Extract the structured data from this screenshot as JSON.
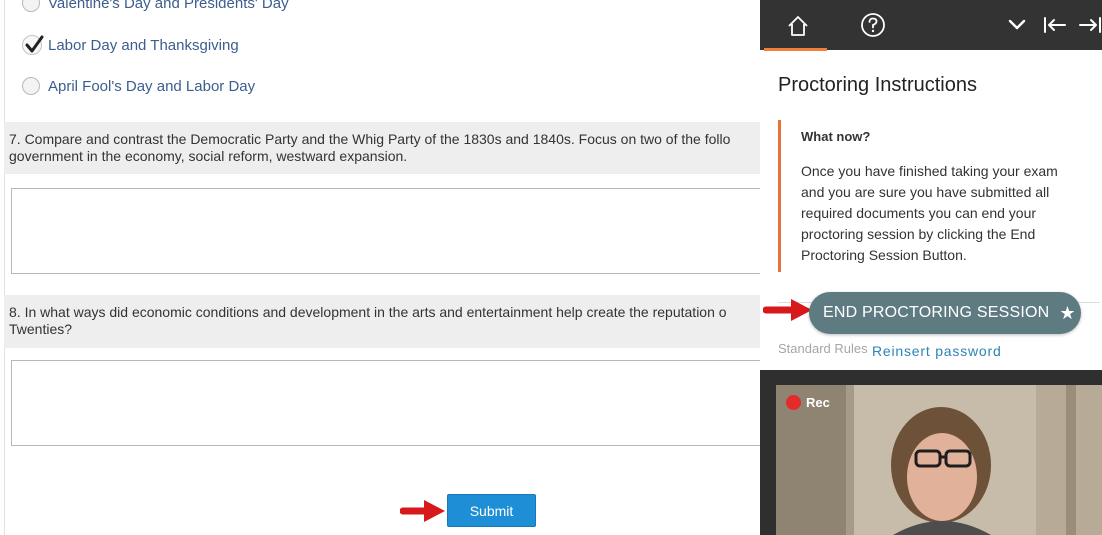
{
  "exam": {
    "options": [
      {
        "label": "Valentine's Day and Presidents' Day",
        "checked": false
      },
      {
        "label": "Labor Day and Thanksgiving",
        "checked": true
      },
      {
        "label": "April Fool's Day and Labor Day",
        "checked": false
      }
    ],
    "question7": {
      "line1": "7. Compare and contrast the Democratic Party and the Whig Party of the 1830s and 1840s. Focus on two of the follo",
      "line2": "government in the economy, social reform, westward expansion."
    },
    "question8": {
      "line1": "8. In what ways did economic conditions and development in the arts and entertainment help create the reputation o",
      "line2": "Twenties?"
    },
    "submit_label": "Submit"
  },
  "panel": {
    "title": "Proctoring Instructions",
    "info_heading": "What now?",
    "info_lines": [
      "Once you have finished taking your exam",
      "and you are sure you have submitted all",
      "required documents you can end your",
      "proctoring session by clicking the End",
      "Proctoring Session Button."
    ],
    "end_button_label": "END PROCTORING SESSION",
    "standard_rules": "Standard Rules",
    "reinsert_password": "Reinsert password",
    "rec_label": "Rec"
  },
  "colors": {
    "accent_orange": "#f07f3c",
    "end_button": "#5f7b82",
    "submit_button": "#1e8fd6",
    "arrow_red": "#d7191c",
    "option_text": "#3c5d8f"
  },
  "icons": {
    "bar": [
      "home-icon",
      "help-icon",
      "chevron-down-icon",
      "collapse-left-icon",
      "expand-right-icon"
    ],
    "checkmark": "checkmark-icon",
    "star": "star-icon"
  }
}
